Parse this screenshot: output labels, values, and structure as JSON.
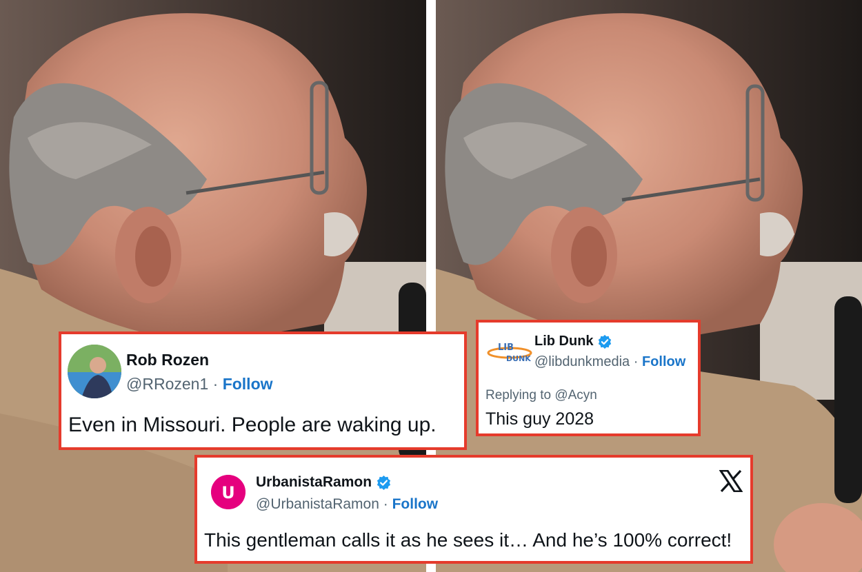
{
  "tweets": [
    {
      "name": "Rob Rozen",
      "handle": "@RRozen1",
      "separator": "·",
      "follow": "Follow",
      "text": "Even in Missouri. People are waking up.",
      "verified": false
    },
    {
      "name": "Lib Dunk",
      "handle": "@libdunkmedia",
      "separator": "·",
      "follow": "Follow",
      "avatar_text_top": "LIB",
      "avatar_text_bottom": "DUNK",
      "reply_to": "Replying to @Acyn",
      "text": "This guy 2028",
      "verified": true
    },
    {
      "name": "UrbanistaRamon",
      "handle": "@UrbanistaRamon",
      "separator": "·",
      "follow": "Follow",
      "avatar_letter": "U",
      "text": "This gentleman calls it as he sees it… And he’s 100% correct!",
      "verified": true,
      "platform_icon": "x-logo-icon"
    }
  ],
  "colors": {
    "border": "#e53b2c",
    "follow": "#1a75c9",
    "verified": "#1d9bf0",
    "urbanista_avatar": "#e5007e"
  }
}
